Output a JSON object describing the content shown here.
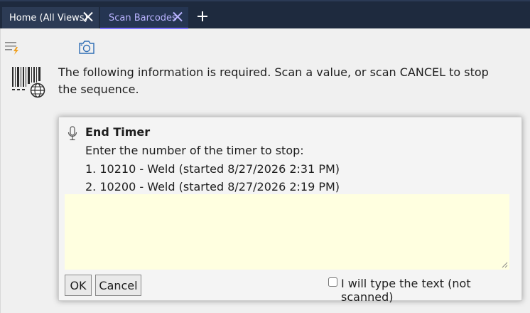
{
  "tabs": [
    {
      "label": "Home (All Views)",
      "active": false
    },
    {
      "label": "Scan Barcodes",
      "active": true
    }
  ],
  "toolbar": {
    "menu_icon": "menu-lightning-icon",
    "camera_icon": "camera-icon"
  },
  "info": {
    "icon": "barcode-globe-icon",
    "text": "The following information is required. Scan a value, or scan CANCEL to stop the sequence."
  },
  "dialog": {
    "icon": "microphone-icon",
    "title": "End Timer",
    "prompt": "Enter the number of the timer to stop:",
    "options": [
      "1. 10210 - Weld (started 8/27/2026 2:31 PM)",
      "2. 10200 - Weld (started 8/27/2026 2:19 PM)"
    ],
    "input_value": "",
    "ok_label": "OK",
    "cancel_label": "Cancel",
    "checkbox_label": "I will type the text (not scanned)",
    "checkbox_checked": false
  },
  "colors": {
    "tabbar_bg": "#1e2a3e",
    "active_tab_text": "#b9b3ff",
    "active_tab_underline": "#7f74ff",
    "input_bg": "#ffffe0",
    "lightning_accent": "#f0a020"
  }
}
